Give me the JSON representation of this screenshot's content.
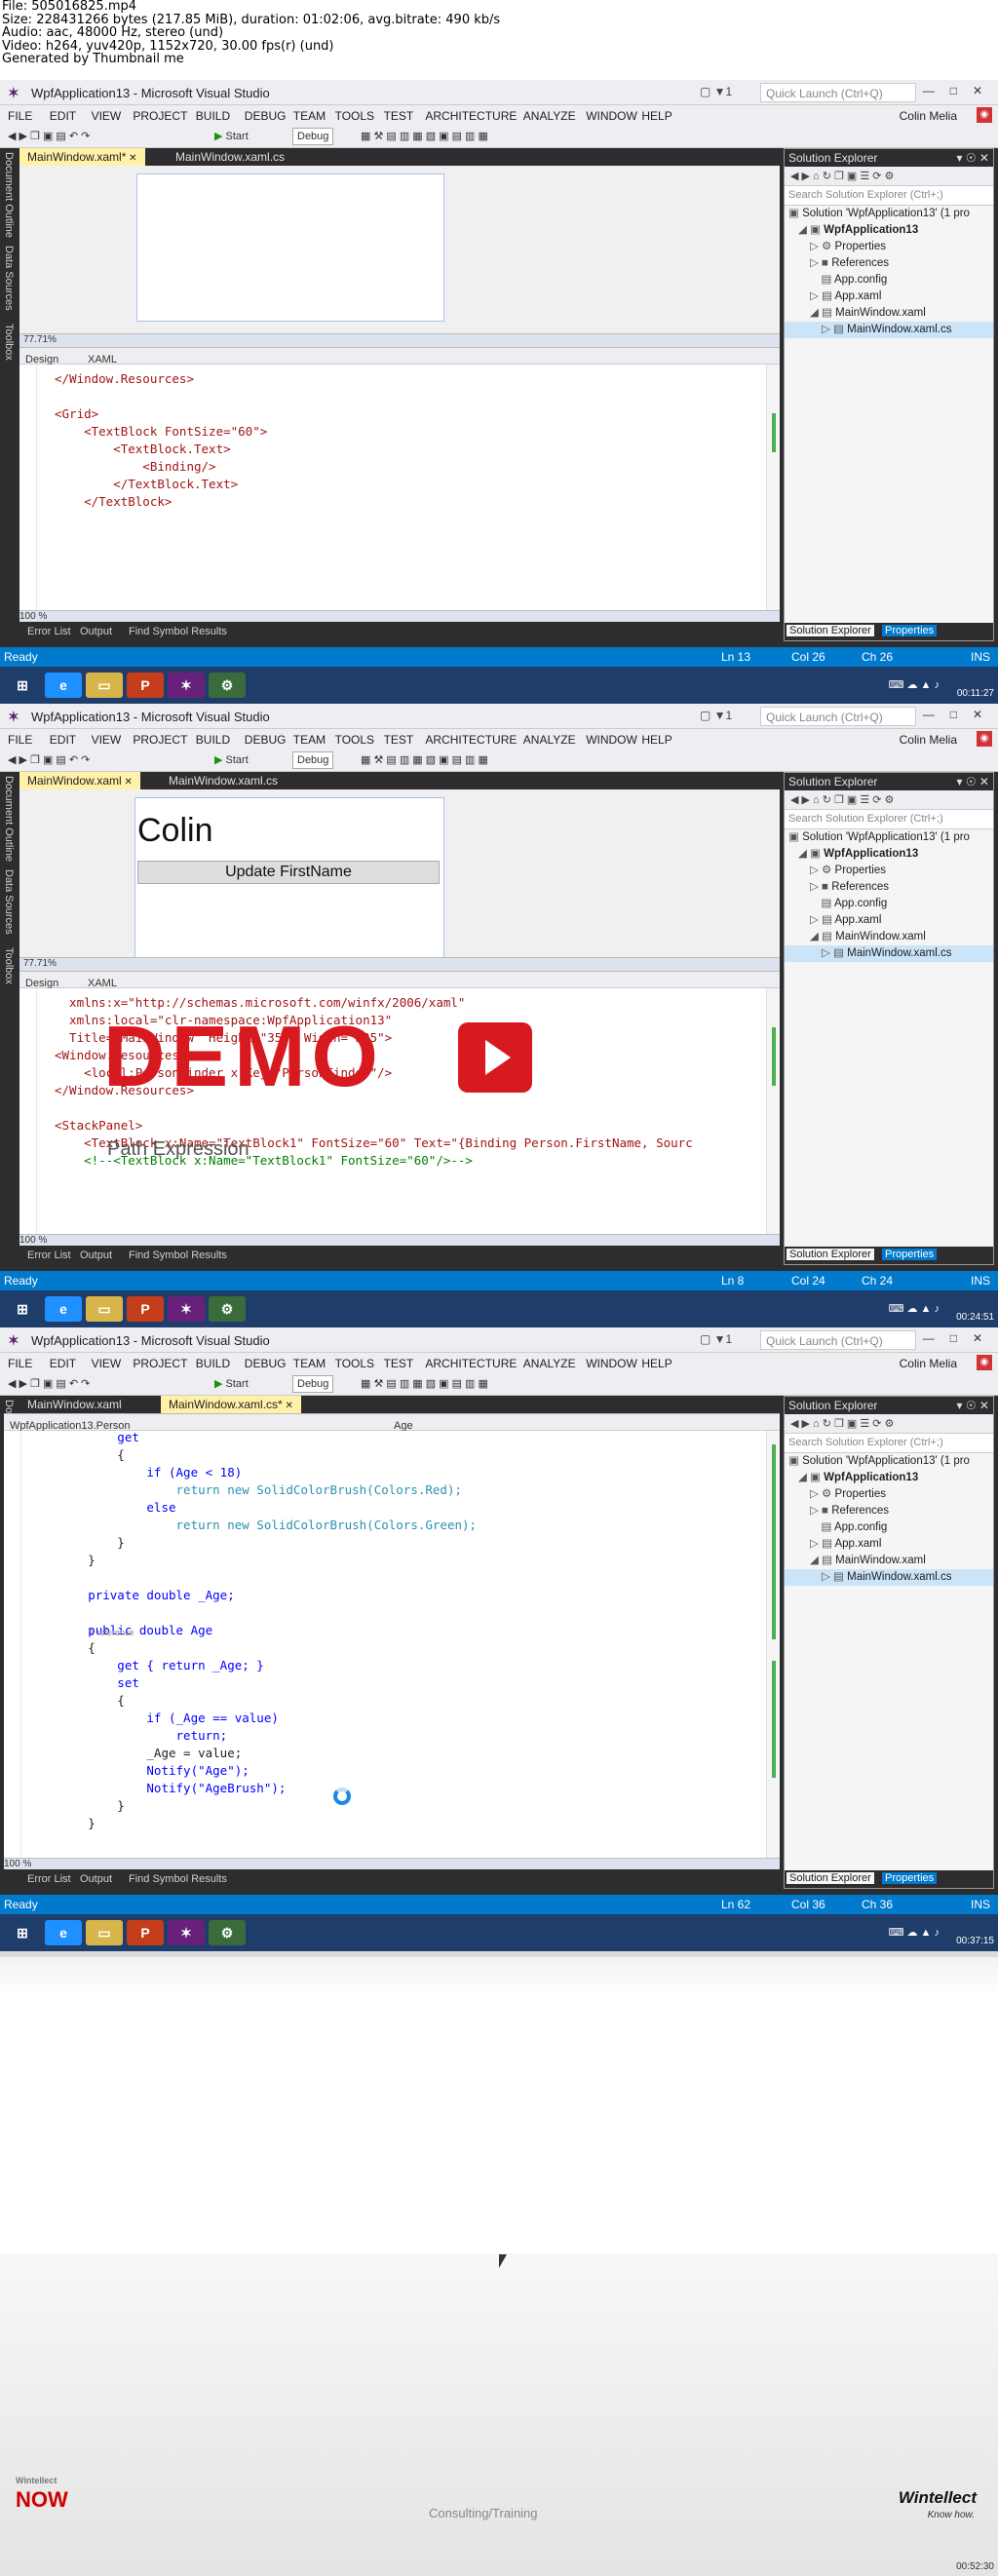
{
  "file_info": {
    "line1": "File: 505016825.mp4",
    "line2": "Size: 228431266 bytes (217.85 MiB), duration: 01:02:06, avg.bitrate: 490 kb/s",
    "line3": "Audio: aac, 48000 Hz, stereo (und)",
    "line4": "Video: h264, yuv420p, 1152x720, 30.00 fps(r) (und)",
    "line5": "Generated by Thumbnail me"
  },
  "vs": {
    "title": "WpfApplication13 - Microsoft Visual Studio",
    "quick_launch": "Quick Launch (Ctrl+Q)",
    "user": "Colin Melia",
    "menu": [
      "FILE",
      "EDIT",
      "VIEW",
      "PROJECT",
      "BUILD",
      "DEBUG",
      "TEAM",
      "TOOLS",
      "TEST",
      "ARCHITECTURE",
      "ANALYZE",
      "WINDOW",
      "HELP"
    ],
    "toolbar_start": "Start",
    "toolbar_config": "Debug",
    "side_tabs": [
      "Document Outline",
      "Data Sources",
      "Toolbox"
    ],
    "bottom_tabs": [
      "Error List",
      "Output",
      "Find Symbol Results"
    ],
    "solution": {
      "title": "Solution Explorer",
      "search": "Search Solution Explorer (Ctrl+;)",
      "tree": [
        "Solution 'WpfApplication13' (1 pro",
        "WpfApplication13",
        "Properties",
        "References",
        "App.config",
        "App.xaml",
        "MainWindow.xaml",
        "MainWindow.xaml.cs"
      ],
      "tab_explorer": "Solution Explorer",
      "tab_properties": "Properties"
    },
    "designer_labels": {
      "design": "Design",
      "xaml": "XAML",
      "zoom": "77.71%",
      "zoom_code": "100 %"
    },
    "status_ready": "Ready"
  },
  "frame1": {
    "tabs": [
      "MainWindow.xaml*",
      "MainWindow.xaml.cs"
    ],
    "code": [
      "</Window.Resources>",
      "",
      "<Grid>",
      "    <TextBlock FontSize=\"60\">",
      "        <TextBlock.Text>",
      "            <Binding/>",
      "        </TextBlock.Text>",
      "    </TextBlock>"
    ],
    "status": {
      "ln": "Ln 13",
      "col": "Col 26",
      "ch": "Ch 26",
      "mode": "INS"
    },
    "timestamp": "00:11:27"
  },
  "frame2": {
    "tabs": [
      "MainWindow.xaml",
      "MainWindow.xaml.cs"
    ],
    "preview_text": "Colin",
    "preview_button": "Update FirstName",
    "code": [
      "  xmlns:x=\"http://schemas.microsoft.com/winfx/2006/xaml\"",
      "  xmlns:local=\"clr-namespace:WpfApplication13\"",
      "  Title=\"MainWindow\" Height=\"350\" Width=\"525\">",
      "<Window.Resources>",
      "    <local:PersonFinder x:Key=\"PersonFinder\"/>",
      "</Window.Resources>",
      "",
      "<StackPanel>",
      "    <TextBlock x:Name=\"TextBlock1\" FontSize=\"60\" Text=\"{Binding Person.FirstName, Sourc",
      "    <!--<TextBlock x:Name=\"TextBlock1\" FontSize=\"60\"/>-->"
    ],
    "status": {
      "ln": "Ln 8",
      "col": "Col 24",
      "ch": "Ch 24",
      "mode": "INS"
    },
    "timestamp": "00:24:51"
  },
  "frame3": {
    "tabs": [
      "MainWindow.xaml",
      "MainWindow.xaml.cs*"
    ],
    "nav_left": "WpfApplication13.Person",
    "nav_right": "Age",
    "code": [
      "            get",
      "            {",
      "                if (Age < 18)",
      "                    return new SolidColorBrush(Colors.Red);",
      "                else",
      "                    return new SolidColorBrush(Colors.Green);",
      "            }",
      "        }",
      "",
      "        private double _Age;",
      "",
      "        public double Age",
      "        {",
      "            get { return _Age; }",
      "            set",
      "            {",
      "                if (_Age == value)",
      "                    return;",
      "                _Age = value;",
      "                Notify(\"Age\");",
      "                Notify(\"AgeBrush\");",
      "            }",
      "        }"
    ],
    "reference_hint": "1 reference",
    "status": {
      "ln": "Ln 62",
      "col": "Col 36",
      "ch": "Ch 36",
      "mode": "INS"
    },
    "timestamp": "00:37:15"
  },
  "frame4": {
    "demo": "DEMO",
    "subtitle": "Path Expression",
    "brand_small": "Wintellect",
    "brand_now": "NOW",
    "consulting": "Consulting/Training",
    "brand_right": "Wintellect",
    "tagline": "Know how.",
    "timestamp": "00:52:30"
  }
}
